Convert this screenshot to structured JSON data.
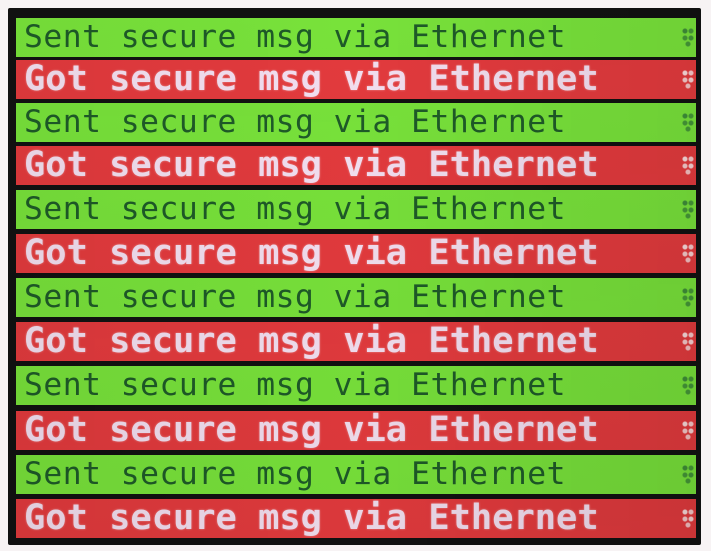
{
  "colors": {
    "sent_background": "#78e23a",
    "sent_text": "#1e5a28",
    "got_background": "#e33a3d",
    "got_text": "#f3dff0"
  },
  "lines": [
    {
      "text": "Sent secure msg via Ethernet",
      "type": "sent",
      "trailing_glyph": "garbled-glyph-icon"
    },
    {
      "text": "Got secure msg via Ethernet",
      "type": "got",
      "trailing_glyph": "garbled-glyph-icon"
    },
    {
      "text": "Sent secure msg via Ethernet",
      "type": "sent",
      "trailing_glyph": "garbled-glyph-icon"
    },
    {
      "text": "Got secure msg via Ethernet",
      "type": "got",
      "trailing_glyph": "garbled-glyph-icon"
    },
    {
      "text": "Sent secure msg via Ethernet",
      "type": "sent",
      "trailing_glyph": "garbled-glyph-icon"
    },
    {
      "text": "Got secure msg via Ethernet",
      "type": "got",
      "trailing_glyph": "garbled-glyph-icon"
    },
    {
      "text": "Sent secure msg via Ethernet",
      "type": "sent",
      "trailing_glyph": "garbled-glyph-icon"
    },
    {
      "text": "Got secure msg via Ethernet",
      "type": "got",
      "trailing_glyph": "garbled-glyph-icon"
    },
    {
      "text": "Sent secure msg via Ethernet",
      "type": "sent",
      "trailing_glyph": "garbled-glyph-icon"
    },
    {
      "text": "Got secure msg via Ethernet",
      "type": "got",
      "trailing_glyph": "garbled-glyph-icon"
    },
    {
      "text": "Sent secure msg via Ethernet",
      "type": "sent",
      "trailing_glyph": "garbled-glyph-icon"
    },
    {
      "text": "Got secure msg via Ethernet",
      "type": "got",
      "trailing_glyph": "garbled-glyph-icon"
    }
  ]
}
